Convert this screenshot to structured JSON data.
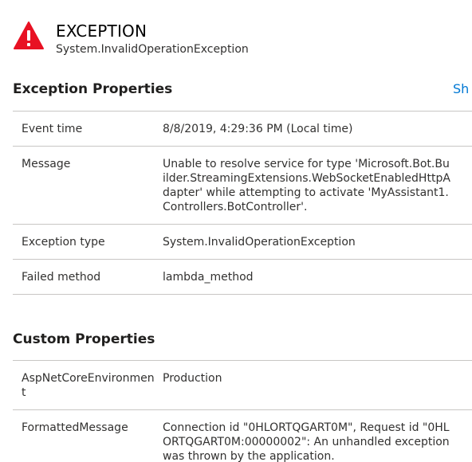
{
  "header": {
    "icon": "warning-triangle-icon",
    "icon_color": "#e81123",
    "title": "EXCEPTION",
    "subtitle": "System.InvalidOperationException"
  },
  "exception_section": {
    "title": "Exception Properties",
    "show_link": "Sh"
  },
  "exception_properties": [
    {
      "key": "Event time",
      "value": "8/8/2019, 4:29:36 PM (Local time)"
    },
    {
      "key": "Message",
      "value": "Unable to resolve service for type 'Microsoft.Bot.Builder.StreamingExtensions.WebSocketEnabledHttpAdapter' while attempting to activate 'MyAssistant1.Controllers.BotController'."
    },
    {
      "key": "Exception type",
      "value": "System.InvalidOperationException"
    },
    {
      "key": "Failed method",
      "value": "lambda_method"
    }
  ],
  "custom_section": {
    "title": "Custom Properties"
  },
  "custom_properties": [
    {
      "key": "AspNetCoreEnvironment",
      "value": "Production"
    },
    {
      "key": "FormattedMessage",
      "value": "Connection id \"0HLORTQGART0M\", Request id \"0HLORTQGART0M:00000002\": An unhandled exception was thrown by the application."
    }
  ]
}
